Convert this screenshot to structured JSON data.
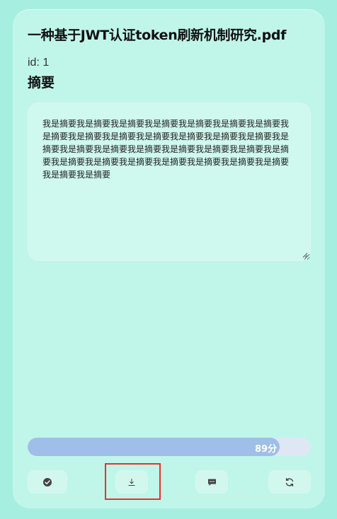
{
  "document": {
    "title": "一种基于JWT认证token刷新机制研究.pdf",
    "id_label": "id: 1",
    "abstract_heading": "摘要",
    "abstract_text": "我是摘要我是摘要我是摘要我是摘要我是摘要我是摘要我是摘要我是摘要我是摘要我是摘要我是摘要我是摘要我是摘要我是摘要我是摘要我是摘要我是摘要我是摘要我是摘要我是摘要我是摘要我是摘要我是摘要我是摘要我是摘要我是摘要我是摘要我是摘要我是摘要我是摘要我是摘要"
  },
  "score": {
    "label": "89分",
    "fraction": 0.89
  },
  "actions": [
    {
      "name": "check-button",
      "icon": "check-circle-icon"
    },
    {
      "name": "download-button",
      "icon": "download-icon"
    },
    {
      "name": "comment-button",
      "icon": "chat-bubble-icon"
    },
    {
      "name": "refresh-button",
      "icon": "refresh-icon"
    }
  ],
  "colors": {
    "background": "#a6eee0",
    "card": "#c0f6ea",
    "progress_fill": "#9fbfe8",
    "progress_track": "#dfe7f5",
    "highlight": "#e8322b"
  }
}
